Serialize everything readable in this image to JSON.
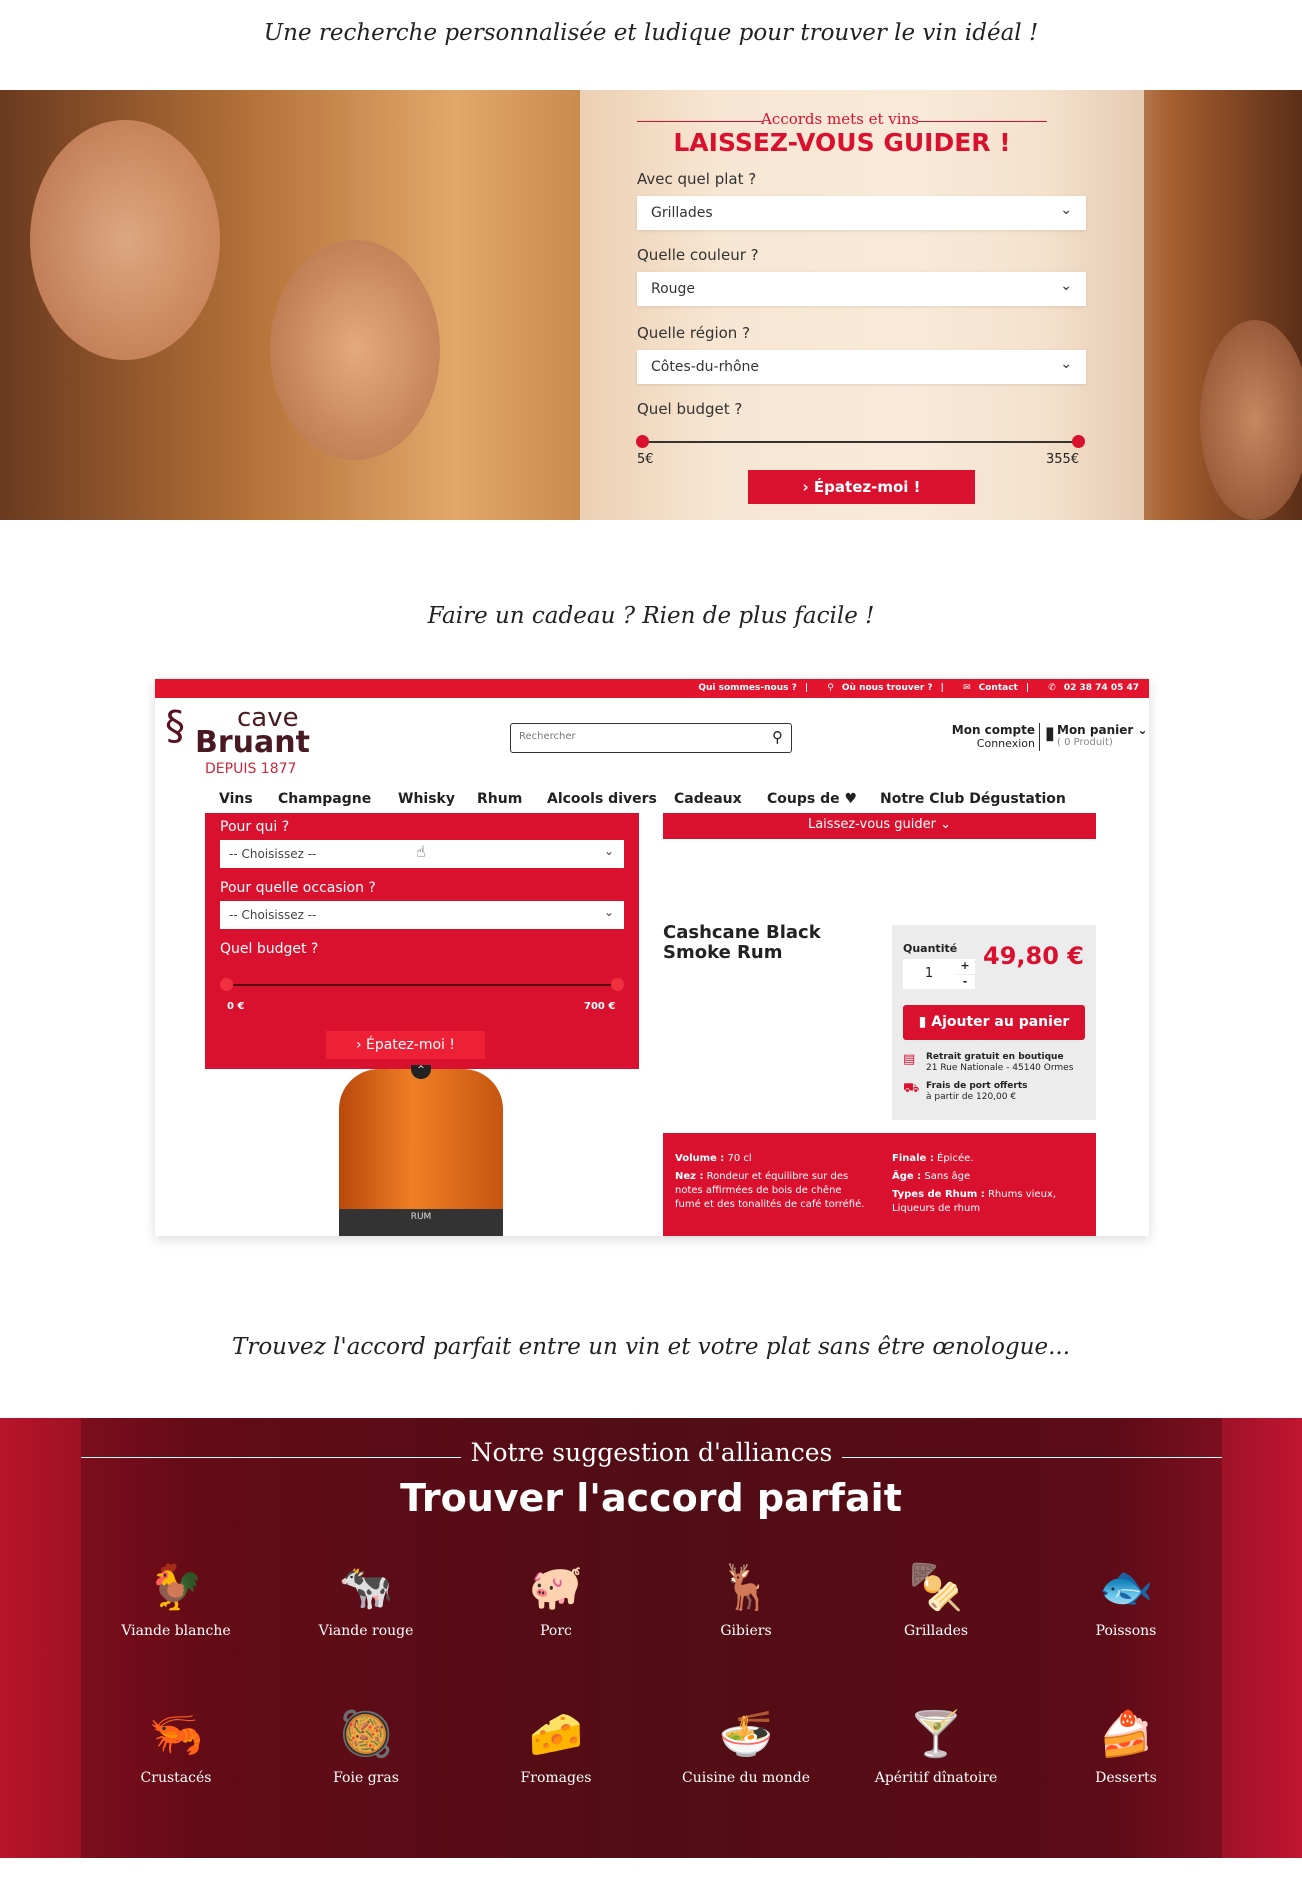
{
  "section1_title": "Une recherche personnalisée et ludique pour trouver le vin idéal !",
  "guide": {
    "kicker": "Accords mets et vins :",
    "title": "LAISSEZ-VOUS GUIDER !",
    "fields": [
      {
        "label": "Avec quel plat ?",
        "value": "Grillades"
      },
      {
        "label": "Quelle couleur ?",
        "value": "Rouge"
      },
      {
        "label": "Quelle région ?",
        "value": "Côtes-du-rhône"
      }
    ],
    "budget_label": "Quel budget ?",
    "budget_min": "5€",
    "budget_max": "355€",
    "button": "› Épatez-moi !"
  },
  "section2_title": "Faire un cadeau ? Rien de plus facile !",
  "site": {
    "topbar": [
      "Qui sommes-nous ?",
      "Où nous trouver ?",
      "Contact",
      "02 38 74 05 47"
    ],
    "logo": {
      "line1": "cave",
      "line2": "Bruant",
      "line3": "DEPUIS 1877"
    },
    "search_placeholder": "Rechercher",
    "account": "Mon compte",
    "login": "Connexion",
    "cart": "Mon panier",
    "cart_count": "( 0 Produit)",
    "nav": [
      "Vins",
      "Champagne",
      "Whisky",
      "Rhum",
      "Alcools divers",
      "Cadeaux",
      "Coups de ♥",
      "Notre Club Dégustation"
    ],
    "gift": {
      "who_label": "Pour qui ?",
      "who_value": "-- Choisissez --",
      "occasion_label": "Pour quelle occasion ?",
      "occasion_value": "-- Choisissez --",
      "budget_label": "Quel budget ?",
      "budget_min": "0 €",
      "budget_max": "700 €",
      "button": "› Épatez-moi !"
    },
    "guide_bar": "Laissez-vous guider ⌄",
    "bottle_label": "RUM",
    "product": {
      "name": "Cashcane Black Smoke Rum",
      "qty_label": "Quantité",
      "qty": "1",
      "price": "49,80 €",
      "add": "Ajouter au panier",
      "pickup_title": "Retrait gratuit en boutique",
      "pickup_addr": "21 Rue Nationale - 45140 Ormes",
      "ship_title": "Frais de port offerts",
      "ship_sub": "à partir de 120,00 €"
    },
    "specs": [
      {
        "k": "Volume :",
        "v": " 70 cl"
      },
      {
        "k": "Nez :",
        "v": " Rondeur et équilibre sur des notes affirmées de bois de chêne fumé et des tonalités de café torréfié."
      },
      {
        "k": "Finale :",
        "v": " Épicée."
      },
      {
        "k": "Âge :",
        "v": " Sans âge"
      },
      {
        "k": "Types de Rhum :",
        "v": " Rhums vieux, Liqueurs de rhum"
      }
    ]
  },
  "section3_title": "Trouvez l'accord parfait entre un vin et votre plat sans être œnologue...",
  "pairing": {
    "kicker": "Notre suggestion d'alliances",
    "title": "Trouver l'accord parfait",
    "items": [
      {
        "label": "Viande blanche",
        "icon": "🐓"
      },
      {
        "label": "Viande rouge",
        "icon": "🐄"
      },
      {
        "label": "Porc",
        "icon": "🐖"
      },
      {
        "label": "Gibiers",
        "icon": "🦌"
      },
      {
        "label": "Grillades",
        "icon": "🍢"
      },
      {
        "label": "Poissons",
        "icon": "🐟"
      },
      {
        "label": "Crustacés",
        "icon": "🦐"
      },
      {
        "label": "Foie gras",
        "icon": "🥘"
      },
      {
        "label": "Fromages",
        "icon": "🧀"
      },
      {
        "label": "Cuisine du monde",
        "icon": "🍜"
      },
      {
        "label": "Apéritif dînatoire",
        "icon": "🍸"
      },
      {
        "label": "Desserts",
        "icon": "🍰"
      }
    ]
  },
  "colors": {
    "accent": "#d9112f"
  }
}
